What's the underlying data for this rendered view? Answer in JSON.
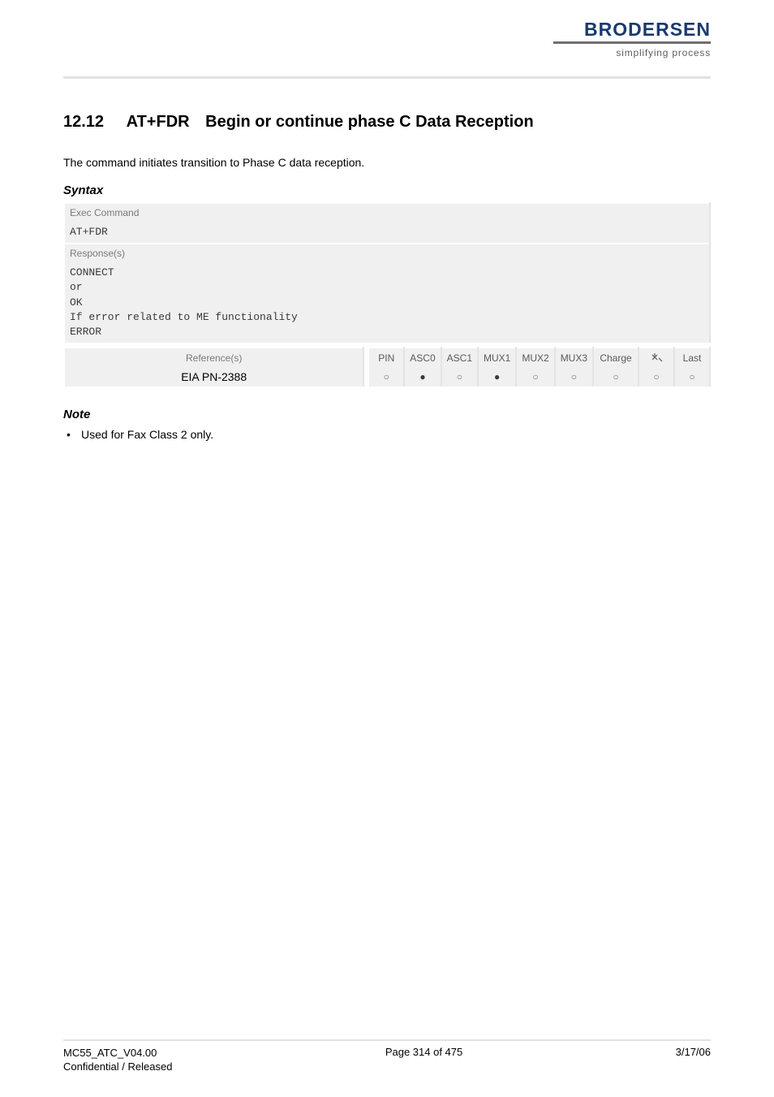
{
  "logo": {
    "name": "BRODERSEN",
    "tagline": "simplifying process"
  },
  "heading": {
    "number": "12.12",
    "command": "AT+FDR",
    "title": "Begin or continue phase C Data Reception"
  },
  "intro": "The command initiates transition to Phase C data reception.",
  "syntax": {
    "label": "Syntax",
    "exec_label": "Exec Command",
    "exec_value": "AT+FDR",
    "response_label": "Response(s)",
    "response_value": "CONNECT\nor\nOK\nIf error related to ME functionality\nERROR",
    "ref_label": "Reference(s)",
    "ref_value": "EIA PN-2388",
    "flags_headers": [
      "PIN",
      "ASC0",
      "ASC1",
      "MUX1",
      "MUX2",
      "MUX3",
      "Charge",
      "",
      "Last"
    ],
    "flags_values": [
      "○",
      "●",
      "○",
      "●",
      "○",
      "○",
      "○",
      "○",
      "○"
    ]
  },
  "note": {
    "label": "Note",
    "items": [
      "Used for Fax Class 2 only."
    ]
  },
  "footer": {
    "left_line1": "MC55_ATC_V04.00",
    "left_line2": "Confidential / Released",
    "center": "Page 314 of 475",
    "right": "3/17/06"
  }
}
